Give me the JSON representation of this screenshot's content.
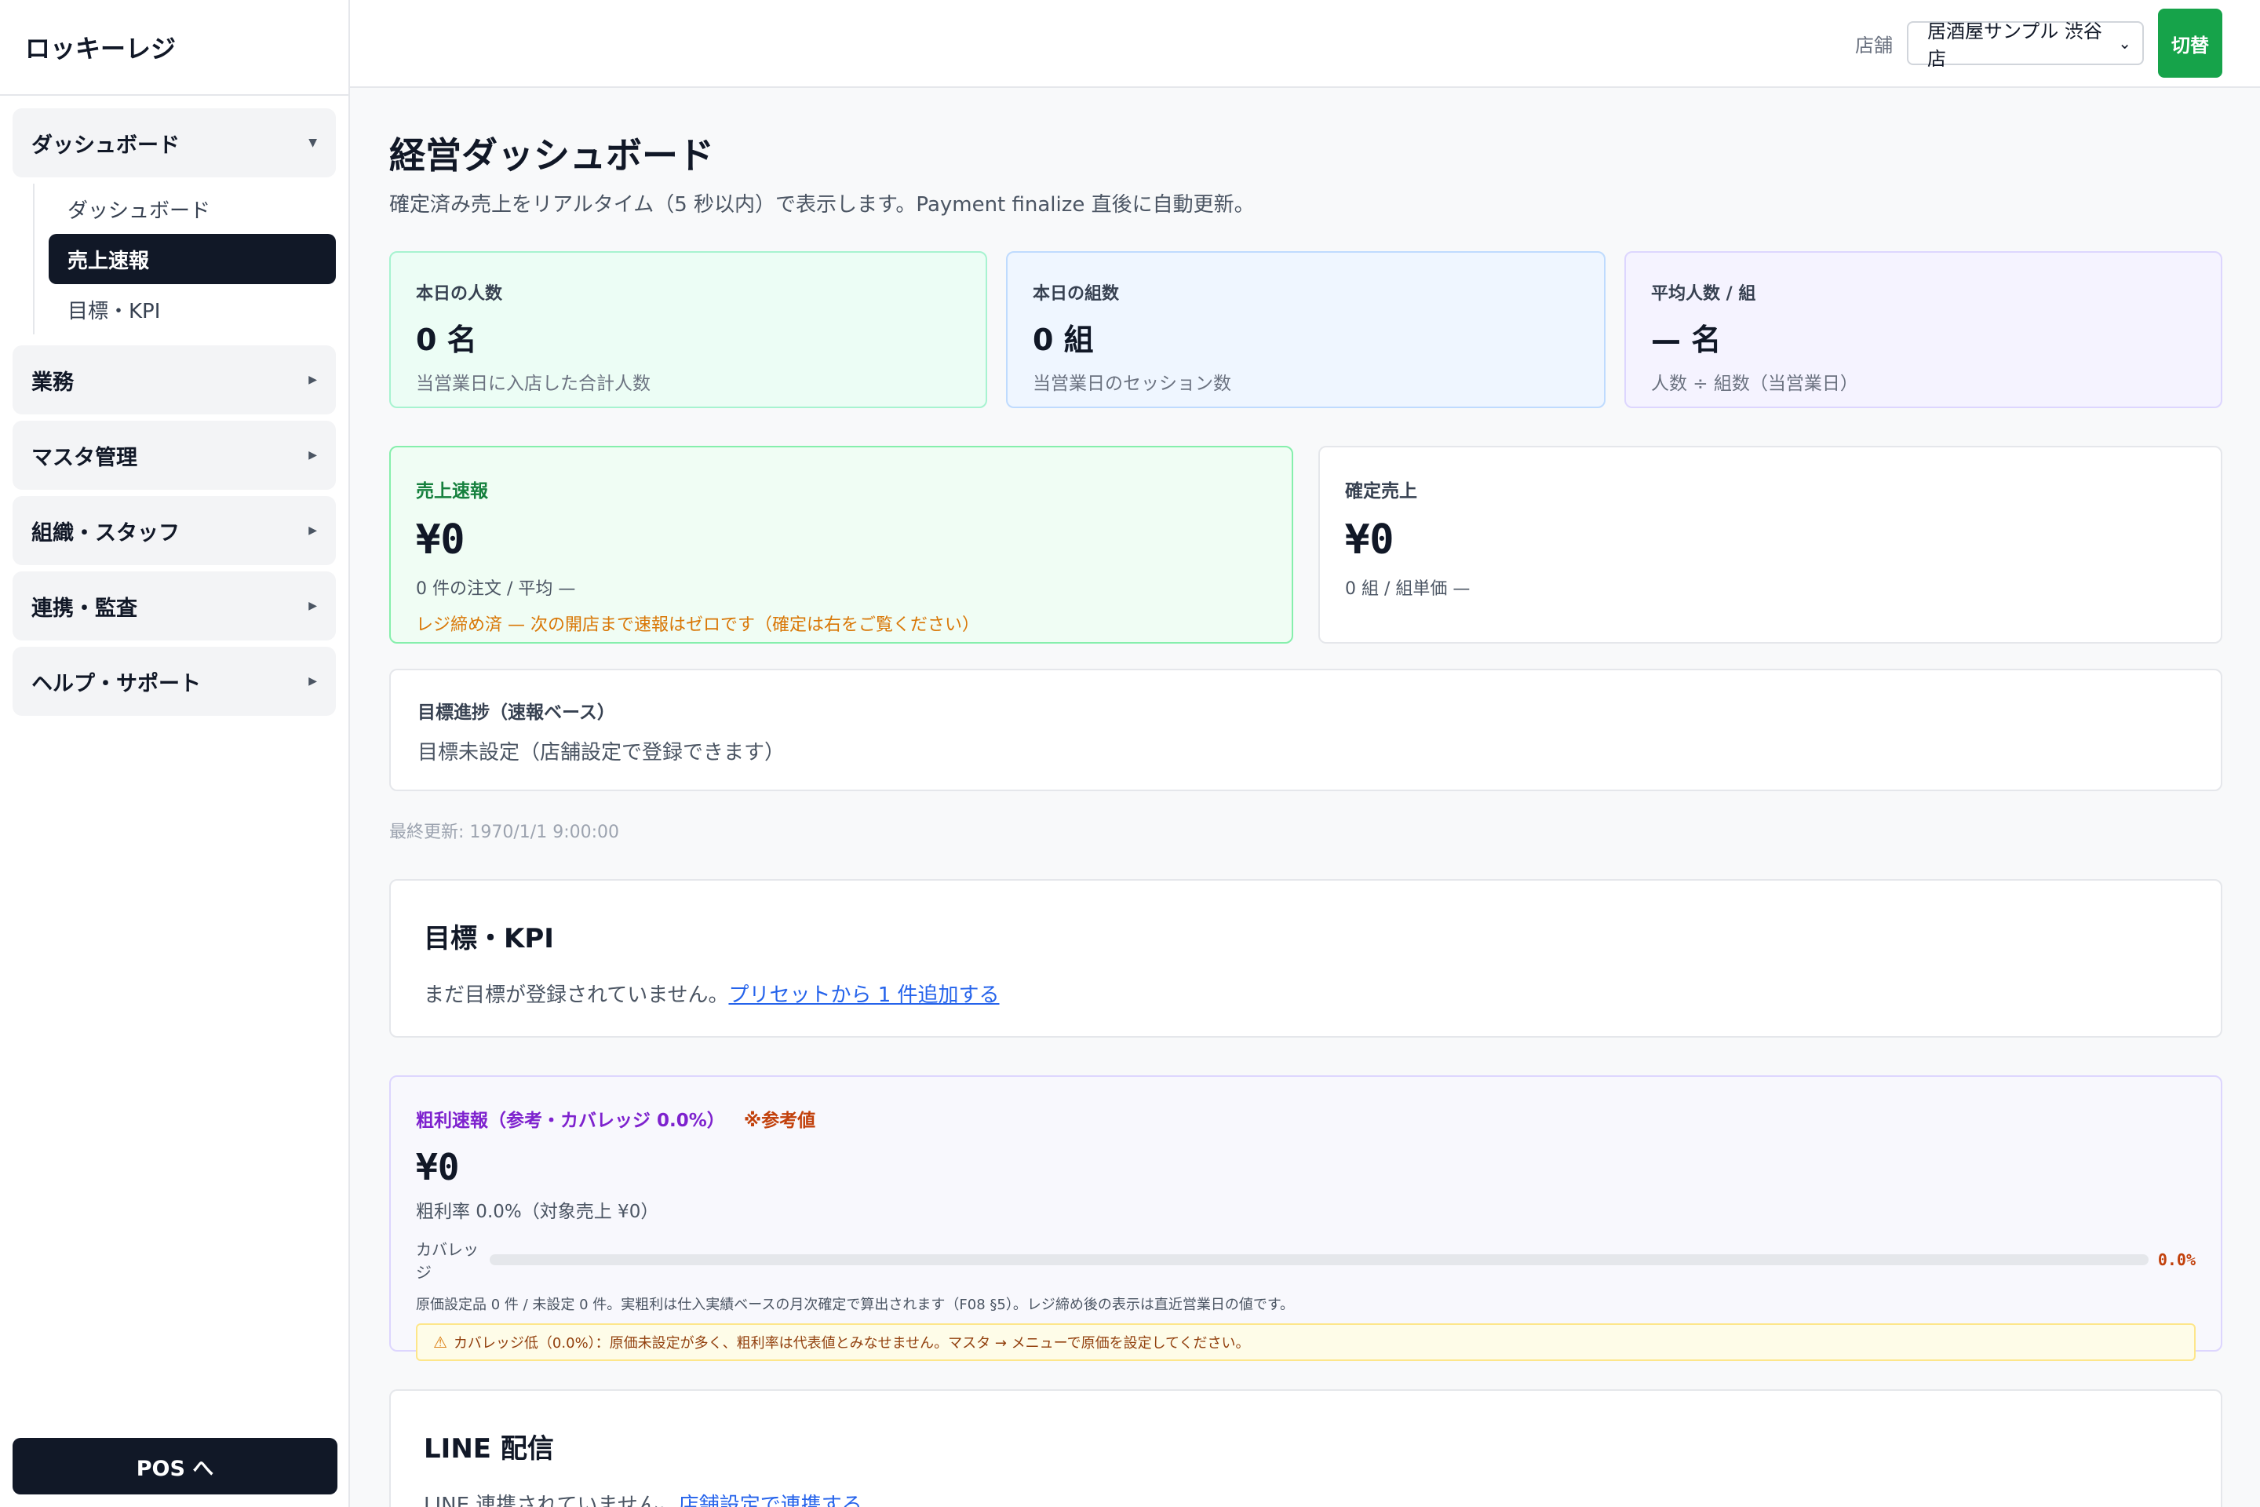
{
  "app": {
    "title": "ロッキーレジ"
  },
  "sidebar": {
    "groups": [
      {
        "label": "ダッシュボード",
        "expanded": true,
        "items": [
          {
            "label": "ダッシュボード"
          },
          {
            "label": "売上速報",
            "active": true
          },
          {
            "label": "目標・KPI"
          }
        ]
      },
      {
        "label": "業務"
      },
      {
        "label": "マスタ管理"
      },
      {
        "label": "組織・スタッフ"
      },
      {
        "label": "連携・監査"
      },
      {
        "label": "ヘルプ・サポート"
      }
    ],
    "pos_label": "POS へ"
  },
  "header": {
    "store_label": "店舗",
    "store_value": "居酒屋サンプル 渋谷店",
    "switch_label": "切替"
  },
  "page": {
    "title": "経営ダッシュボード",
    "subtitle": "確定済み売上をリアルタイム（5 秒以内）で表示します。Payment finalize 直後に自動更新。"
  },
  "kpis": [
    {
      "label": "本日の人数",
      "value": "0 名",
      "note": "当営業日に入店した合計人数"
    },
    {
      "label": "本日の組数",
      "value": "0 組",
      "note": "当営業日のセッション数"
    },
    {
      "label": "平均人数 / 組",
      "value": "— 名",
      "note": "人数 ÷ 組数（当営業日）"
    }
  ],
  "flash_sales": {
    "label": "売上速報",
    "value": "¥0",
    "detail": "0 件の注文 / 平均 —",
    "notice": "レジ締め済 — 次の開店まで速報はゼロです（確定は右をご覧ください）"
  },
  "confirmed_sales": {
    "label": "確定売上",
    "value": "¥0",
    "detail": "0 組 / 組単価 —"
  },
  "goal_progress": {
    "label": "目標進捗（速報ベース）",
    "message": "目標未設定（店舗設定で登録できます）"
  },
  "last_updated": "最終更新: 1970/1/1 9:00:00",
  "kpi_section": {
    "title": "目標・KPI",
    "message": "まだ目標が登録されていません。",
    "link": "プリセットから 1 件追加する"
  },
  "gross_profit": {
    "label": "粗利速報（参考・カバレッジ 0.0%）",
    "ref_badge": "※参考値",
    "value": "¥0",
    "rate": "粗利率 0.0%（対象売上 ¥0）",
    "coverage_label": "カバレッジ",
    "coverage_value": "0.0%",
    "coverage_fraction": 0.0,
    "note": "原価設定品 0 件 / 未設定 0 件。実粗利は仕入実績ベースの月次確定で算出されます（F08 §5）。レジ締め後の表示は直近営業日の値です。",
    "warning": "カバレッジ低（0.0%）：原価未設定が多く、粗利率は代表値とみなせません。マスタ → メニューで原価を設定してください。"
  },
  "line_section": {
    "title": "LINE 配信",
    "message": "LINE 連携されていません。",
    "link": "店舗設定で連携する"
  },
  "colors": {
    "accent_green": "#16a34a",
    "dark": "#111827",
    "warning_orange": "#d97706",
    "purple": "#7e22ce",
    "link_blue": "#2563eb"
  }
}
